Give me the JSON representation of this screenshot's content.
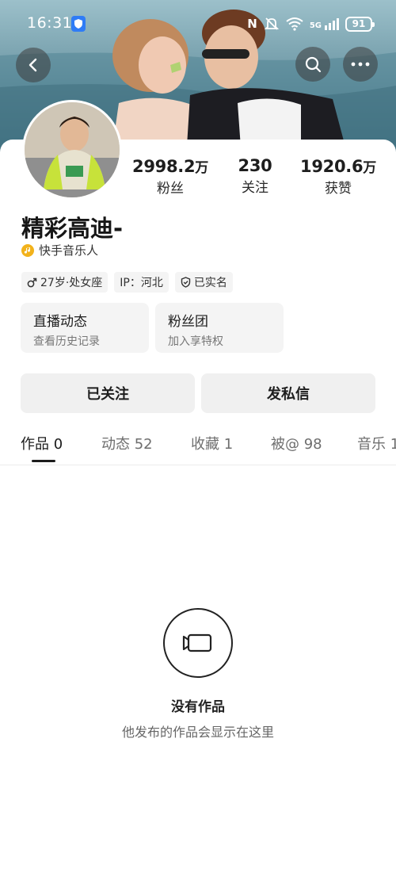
{
  "status_bar": {
    "time": "16:31",
    "network": "5G",
    "battery": "91"
  },
  "cover": {
    "description_icon": "couple-photo"
  },
  "profile": {
    "name": "精彩高迪-",
    "badge": "快手音乐人",
    "stats": [
      {
        "value": "2998.2",
        "unit": "万",
        "label": "粉丝"
      },
      {
        "value": "230",
        "unit": "",
        "label": "关注"
      },
      {
        "value": "1920.6",
        "unit": "万",
        "label": "获赞"
      }
    ],
    "tags": {
      "age": "27岁·处女座",
      "ip": "IP：河北",
      "verified": "已实名"
    },
    "features": [
      {
        "title": "直播动态",
        "subtitle": "查看历史记录"
      },
      {
        "title": "粉丝团",
        "subtitle": "加入享特权"
      }
    ],
    "actions": {
      "follow": "已关注",
      "message": "发私信"
    }
  },
  "tabs": [
    {
      "label": "作品 0"
    },
    {
      "label": "动态 52"
    },
    {
      "label": "收藏 1"
    },
    {
      "label": "被@ 98"
    },
    {
      "label": "音乐 1"
    }
  ],
  "empty_state": {
    "title": "没有作品",
    "subtitle": "他发布的作品会显示在这里"
  },
  "colors": {
    "badge_gold": "#f2b21b",
    "button_bg": "#f0f0f0"
  }
}
